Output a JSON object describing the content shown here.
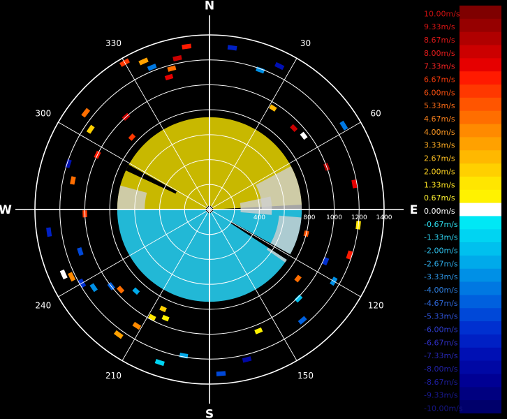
{
  "chart_data": {
    "type": "heatmap",
    "title": "",
    "projection": "polar-ppi",
    "orientation": "north-up, clockwise azimuth",
    "range_max": 1400,
    "range_ticks": [
      200,
      400,
      600,
      800,
      1000,
      1200,
      1400
    ],
    "range_tick_labels": [
      "400",
      "800",
      "1000",
      "1200",
      "1400"
    ],
    "cardinal_labels": [
      {
        "label": "N",
        "az": 0
      },
      {
        "label": "E",
        "az": 90
      },
      {
        "label": "S",
        "az": 180
      },
      {
        "label": "W",
        "az": 270
      }
    ],
    "azimuth_labels": [
      {
        "label": "30",
        "az": 30
      },
      {
        "label": "60",
        "az": 60
      },
      {
        "label": "120",
        "az": 120
      },
      {
        "label": "150",
        "az": 150
      },
      {
        "label": "210",
        "az": 210
      },
      {
        "label": "240",
        "az": 240
      },
      {
        "label": "300",
        "az": 300
      },
      {
        "label": "330",
        "az": 330
      }
    ],
    "spokes_deg": [
      0,
      30,
      60,
      90,
      120,
      150,
      180,
      210,
      240,
      270,
      300,
      330
    ],
    "value_unit": "m/s",
    "color_scale": [
      {
        "value": 10.0,
        "label": "10.00m/s",
        "color": "#7f0000",
        "text_color": "#cc1111"
      },
      {
        "value": 9.33,
        "label": "9.33m/s",
        "color": "#960000",
        "text_color": "#d41414"
      },
      {
        "value": 8.67,
        "label": "8.67m/s",
        "color": "#b00000",
        "text_color": "#dd1818"
      },
      {
        "value": 8.0,
        "label": "8.00m/s",
        "color": "#cc0000",
        "text_color": "#e61c1c"
      },
      {
        "value": 7.33,
        "label": "7.33m/s",
        "color": "#e60000",
        "text_color": "#ee2222"
      },
      {
        "value": 6.67,
        "label": "6.67m/s",
        "color": "#ff1a00",
        "text_color": "#f43a0a"
      },
      {
        "value": 6.0,
        "label": "6.00m/s",
        "color": "#ff3800",
        "text_color": "#f75010"
      },
      {
        "value": 5.33,
        "label": "5.33m/s",
        "color": "#ff5500",
        "text_color": "#f86a16"
      },
      {
        "value": 4.67,
        "label": "4.67m/s",
        "color": "#ff6e00",
        "text_color": "#f9801c"
      },
      {
        "value": 4.0,
        "label": "4.00m/s",
        "color": "#ff8a00",
        "text_color": "#fa9622"
      },
      {
        "value": 3.33,
        "label": "3.33m/s",
        "color": "#ffa100",
        "text_color": "#fbaa22"
      },
      {
        "value": 2.67,
        "label": "2.67m/s",
        "color": "#ffb800",
        "text_color": "#fcbe22"
      },
      {
        "value": 2.0,
        "label": "2.00m/s",
        "color": "#ffd000",
        "text_color": "#fdd222"
      },
      {
        "value": 1.33,
        "label": "1.33m/s",
        "color": "#ffe600",
        "text_color": "#fee422"
      },
      {
        "value": 0.67,
        "label": "0.67m/s",
        "color": "#fff200",
        "text_color": "#fff233"
      },
      {
        "value": 0.0,
        "label": "0.00m/s",
        "color": "#ffffff",
        "text_color": "#ffffff"
      },
      {
        "value": -0.67,
        "label": "-0.67m/s",
        "color": "#00e8f5",
        "text_color": "#2ee0f0"
      },
      {
        "value": -1.33,
        "label": "-1.33m/s",
        "color": "#00d4f2",
        "text_color": "#2ed0ee"
      },
      {
        "value": -2.0,
        "label": "-2.00m/s",
        "color": "#00c0ee",
        "text_color": "#2ebfea"
      },
      {
        "value": -2.67,
        "label": "-2.67m/s",
        "color": "#00aaea",
        "text_color": "#2eaae6"
      },
      {
        "value": -3.33,
        "label": "-3.33m/s",
        "color": "#0090e6",
        "text_color": "#2e94e2"
      },
      {
        "value": -4.0,
        "label": "-4.00m/s",
        "color": "#0078e2",
        "text_color": "#2e7ede"
      },
      {
        "value": -4.67,
        "label": "-4.67m/s",
        "color": "#0060de",
        "text_color": "#2e68da"
      },
      {
        "value": -5.33,
        "label": "-5.33m/s",
        "color": "#0048d8",
        "text_color": "#2e52d4"
      },
      {
        "value": -6.0,
        "label": "-6.00m/s",
        "color": "#0030d0",
        "text_color": "#2e3ccc"
      },
      {
        "value": -6.67,
        "label": "-6.67m/s",
        "color": "#0020c4",
        "text_color": "#2e2ec0"
      },
      {
        "value": -7.33,
        "label": "-7.33m/s",
        "color": "#0010b4",
        "text_color": "#2828b4"
      },
      {
        "value": -8.0,
        "label": "-8.00m/s",
        "color": "#0008a4",
        "text_color": "#2222a8"
      },
      {
        "value": -8.67,
        "label": "-8.67m/s",
        "color": "#000094",
        "text_color": "#1e1e9c"
      },
      {
        "value": -9.33,
        "label": "-9.33m/s",
        "color": "#000080",
        "text_color": "#1a1a90"
      },
      {
        "value": -10.0,
        "label": "-10.00m/s",
        "color": "#00006b",
        "text_color": "#161684"
      }
    ],
    "fill_colors": {
      "positive_main": "#c8b800",
      "negative_main": "#22b8d6",
      "no_data": "#cfcfcf",
      "blocked": "#000000"
    },
    "echo_regions": [
      {
        "az_start": 300,
        "az_end": 60,
        "range_start": 30,
        "range_end": 740,
        "value": 0.67
      },
      {
        "az_start": 60,
        "az_end": 87,
        "range_start": 30,
        "range_end": 740,
        "value": 0.67
      },
      {
        "az_start": 270,
        "az_end": 300,
        "range_start": 30,
        "range_end": 740,
        "value": 0.67
      },
      {
        "az_start": 90,
        "az_end": 270,
        "range_start": 30,
        "range_end": 740,
        "value": -2.0
      }
    ],
    "outer_gates": [
      {
        "az": 352,
        "range": 1320,
        "value": 6.67
      },
      {
        "az": 348,
        "range": 1240,
        "value": 8.0
      },
      {
        "az": 345,
        "range": 1170,
        "value": 4.67
      },
      {
        "az": 343,
        "range": 1110,
        "value": 7.33
      },
      {
        "az": 338,
        "range": 1230,
        "value": -4.0
      },
      {
        "az": 336,
        "range": 1300,
        "value": 3.33
      },
      {
        "az": 330,
        "range": 1360,
        "value": 6.0
      },
      {
        "az": 8,
        "range": 1310,
        "value": -6.67
      },
      {
        "az": 20,
        "range": 1190,
        "value": -3.33
      },
      {
        "az": 26,
        "range": 1280,
        "value": -7.33
      },
      {
        "az": 32,
        "range": 960,
        "value": 2.67
      },
      {
        "az": 46,
        "range": 940,
        "value": 8.0
      },
      {
        "az": 52,
        "range": 960,
        "value": 0.0
      },
      {
        "az": 58,
        "range": 1270,
        "value": -4.0
      },
      {
        "az": 70,
        "range": 1000,
        "value": 8.67
      },
      {
        "az": 80,
        "range": 1180,
        "value": 7.33
      },
      {
        "az": 96,
        "range": 1200,
        "value": 1.33
      },
      {
        "az": 104,
        "range": 800,
        "value": 5.33
      },
      {
        "az": 108,
        "range": 1180,
        "value": 6.67
      },
      {
        "az": 114,
        "range": 1020,
        "value": -6.0
      },
      {
        "az": 120,
        "range": 1150,
        "value": -3.33
      },
      {
        "az": 128,
        "range": 900,
        "value": 4.67
      },
      {
        "az": 135,
        "range": 1010,
        "value": -2.0
      },
      {
        "az": 140,
        "range": 1160,
        "value": -4.67
      },
      {
        "az": 158,
        "range": 1050,
        "value": 0.67
      },
      {
        "az": 166,
        "range": 1240,
        "value": -8.0
      },
      {
        "az": 176,
        "range": 1320,
        "value": -5.33
      },
      {
        "az": 190,
        "range": 1190,
        "value": -2.67
      },
      {
        "az": 198,
        "range": 1290,
        "value": -1.33
      },
      {
        "az": 202,
        "range": 940,
        "value": 0.67
      },
      {
        "az": 205,
        "range": 880,
        "value": 2.0
      },
      {
        "az": 208,
        "range": 980,
        "value": 1.33
      },
      {
        "az": 212,
        "range": 1100,
        "value": 4.0
      },
      {
        "az": 216,
        "range": 1240,
        "value": 3.33
      },
      {
        "az": 222,
        "range": 880,
        "value": -2.67
      },
      {
        "az": 228,
        "range": 960,
        "value": 4.67
      },
      {
        "az": 232,
        "range": 1000,
        "value": -4.67
      },
      {
        "az": 236,
        "range": 1120,
        "value": -3.33
      },
      {
        "az": 240,
        "range": 1180,
        "value": -6.0
      },
      {
        "az": 244,
        "range": 1230,
        "value": 4.0
      },
      {
        "az": 246,
        "range": 1280,
        "value": 0.0
      },
      {
        "az": 252,
        "range": 1090,
        "value": -5.33
      },
      {
        "az": 262,
        "range": 1300,
        "value": -6.67
      },
      {
        "az": 268,
        "range": 1000,
        "value": 6.0
      },
      {
        "az": 282,
        "range": 1120,
        "value": 4.67
      },
      {
        "az": 288,
        "range": 1190,
        "value": -7.33
      },
      {
        "az": 296,
        "range": 1000,
        "value": 6.67
      },
      {
        "az": 304,
        "range": 1150,
        "value": 2.0
      },
      {
        "az": 308,
        "range": 1260,
        "value": 4.67
      },
      {
        "az": 313,
        "range": 850,
        "value": 6.0
      },
      {
        "az": 318,
        "range": 1000,
        "value": 8.0
      }
    ]
  }
}
